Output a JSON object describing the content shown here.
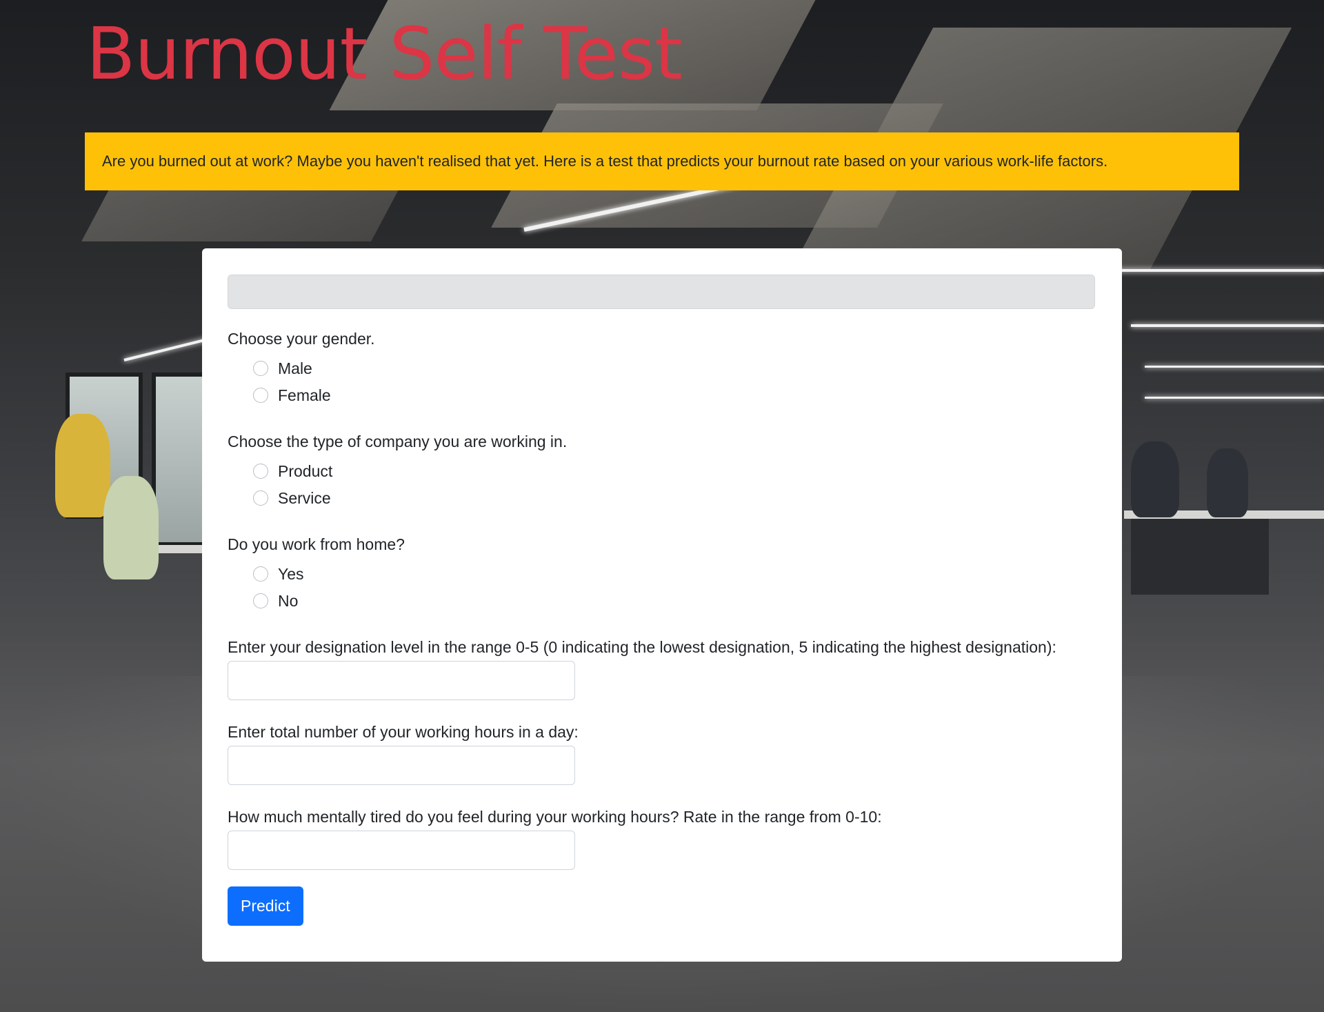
{
  "page": {
    "title": "Burnout Self Test",
    "intro": "Are you burned out at work? Maybe you haven't realised that yet. Here is a test that predicts your burnout rate based on your various work-life factors.",
    "colors": {
      "title": "#dc3545",
      "banner": "#ffc107",
      "button": "#0d6efd",
      "result_bar": "#e2e3e5"
    }
  },
  "form": {
    "result_text": "",
    "gender": {
      "question": "Choose your gender.",
      "options": [
        "Male",
        "Female"
      ],
      "selected": null
    },
    "company": {
      "question": "Choose the type of company you are working in.",
      "options": [
        "Product",
        "Service"
      ],
      "selected": null
    },
    "wfh": {
      "question": "Do you work from home?",
      "options": [
        "Yes",
        "No"
      ],
      "selected": null
    },
    "designation": {
      "question": "Enter your designation level in the range 0-5 (0 indicating the lowest designation, 5 indicating the highest designation):",
      "value": ""
    },
    "hours": {
      "question": "Enter total number of your working hours in a day:",
      "value": ""
    },
    "fatigue": {
      "question": "How much mentally tired do you feel during your working hours? Rate in the range from 0-10:",
      "value": ""
    },
    "submit_label": "Predict"
  }
}
